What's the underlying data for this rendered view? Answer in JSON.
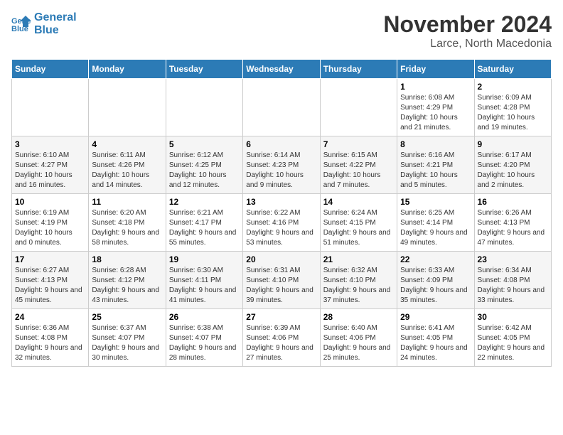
{
  "header": {
    "logo_line1": "General",
    "logo_line2": "Blue",
    "month": "November 2024",
    "location": "Larce, North Macedonia"
  },
  "days_of_week": [
    "Sunday",
    "Monday",
    "Tuesday",
    "Wednesday",
    "Thursday",
    "Friday",
    "Saturday"
  ],
  "weeks": [
    [
      {
        "day": "",
        "info": ""
      },
      {
        "day": "",
        "info": ""
      },
      {
        "day": "",
        "info": ""
      },
      {
        "day": "",
        "info": ""
      },
      {
        "day": "",
        "info": ""
      },
      {
        "day": "1",
        "info": "Sunrise: 6:08 AM\nSunset: 4:29 PM\nDaylight: 10 hours and 21 minutes."
      },
      {
        "day": "2",
        "info": "Sunrise: 6:09 AM\nSunset: 4:28 PM\nDaylight: 10 hours and 19 minutes."
      }
    ],
    [
      {
        "day": "3",
        "info": "Sunrise: 6:10 AM\nSunset: 4:27 PM\nDaylight: 10 hours and 16 minutes."
      },
      {
        "day": "4",
        "info": "Sunrise: 6:11 AM\nSunset: 4:26 PM\nDaylight: 10 hours and 14 minutes."
      },
      {
        "day": "5",
        "info": "Sunrise: 6:12 AM\nSunset: 4:25 PM\nDaylight: 10 hours and 12 minutes."
      },
      {
        "day": "6",
        "info": "Sunrise: 6:14 AM\nSunset: 4:23 PM\nDaylight: 10 hours and 9 minutes."
      },
      {
        "day": "7",
        "info": "Sunrise: 6:15 AM\nSunset: 4:22 PM\nDaylight: 10 hours and 7 minutes."
      },
      {
        "day": "8",
        "info": "Sunrise: 6:16 AM\nSunset: 4:21 PM\nDaylight: 10 hours and 5 minutes."
      },
      {
        "day": "9",
        "info": "Sunrise: 6:17 AM\nSunset: 4:20 PM\nDaylight: 10 hours and 2 minutes."
      }
    ],
    [
      {
        "day": "10",
        "info": "Sunrise: 6:19 AM\nSunset: 4:19 PM\nDaylight: 10 hours and 0 minutes."
      },
      {
        "day": "11",
        "info": "Sunrise: 6:20 AM\nSunset: 4:18 PM\nDaylight: 9 hours and 58 minutes."
      },
      {
        "day": "12",
        "info": "Sunrise: 6:21 AM\nSunset: 4:17 PM\nDaylight: 9 hours and 55 minutes."
      },
      {
        "day": "13",
        "info": "Sunrise: 6:22 AM\nSunset: 4:16 PM\nDaylight: 9 hours and 53 minutes."
      },
      {
        "day": "14",
        "info": "Sunrise: 6:24 AM\nSunset: 4:15 PM\nDaylight: 9 hours and 51 minutes."
      },
      {
        "day": "15",
        "info": "Sunrise: 6:25 AM\nSunset: 4:14 PM\nDaylight: 9 hours and 49 minutes."
      },
      {
        "day": "16",
        "info": "Sunrise: 6:26 AM\nSunset: 4:13 PM\nDaylight: 9 hours and 47 minutes."
      }
    ],
    [
      {
        "day": "17",
        "info": "Sunrise: 6:27 AM\nSunset: 4:13 PM\nDaylight: 9 hours and 45 minutes."
      },
      {
        "day": "18",
        "info": "Sunrise: 6:28 AM\nSunset: 4:12 PM\nDaylight: 9 hours and 43 minutes."
      },
      {
        "day": "19",
        "info": "Sunrise: 6:30 AM\nSunset: 4:11 PM\nDaylight: 9 hours and 41 minutes."
      },
      {
        "day": "20",
        "info": "Sunrise: 6:31 AM\nSunset: 4:10 PM\nDaylight: 9 hours and 39 minutes."
      },
      {
        "day": "21",
        "info": "Sunrise: 6:32 AM\nSunset: 4:10 PM\nDaylight: 9 hours and 37 minutes."
      },
      {
        "day": "22",
        "info": "Sunrise: 6:33 AM\nSunset: 4:09 PM\nDaylight: 9 hours and 35 minutes."
      },
      {
        "day": "23",
        "info": "Sunrise: 6:34 AM\nSunset: 4:08 PM\nDaylight: 9 hours and 33 minutes."
      }
    ],
    [
      {
        "day": "24",
        "info": "Sunrise: 6:36 AM\nSunset: 4:08 PM\nDaylight: 9 hours and 32 minutes."
      },
      {
        "day": "25",
        "info": "Sunrise: 6:37 AM\nSunset: 4:07 PM\nDaylight: 9 hours and 30 minutes."
      },
      {
        "day": "26",
        "info": "Sunrise: 6:38 AM\nSunset: 4:07 PM\nDaylight: 9 hours and 28 minutes."
      },
      {
        "day": "27",
        "info": "Sunrise: 6:39 AM\nSunset: 4:06 PM\nDaylight: 9 hours and 27 minutes."
      },
      {
        "day": "28",
        "info": "Sunrise: 6:40 AM\nSunset: 4:06 PM\nDaylight: 9 hours and 25 minutes."
      },
      {
        "day": "29",
        "info": "Sunrise: 6:41 AM\nSunset: 4:05 PM\nDaylight: 9 hours and 24 minutes."
      },
      {
        "day": "30",
        "info": "Sunrise: 6:42 AM\nSunset: 4:05 PM\nDaylight: 9 hours and 22 minutes."
      }
    ]
  ]
}
